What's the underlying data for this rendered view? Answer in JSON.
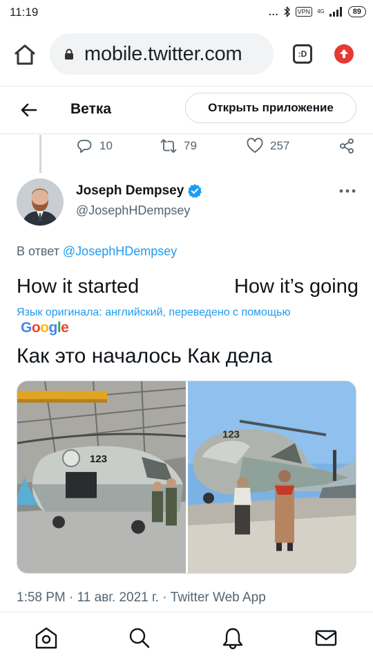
{
  "status_bar": {
    "time": "11:19",
    "dots": "...",
    "vpn": "VPN",
    "network": "4G",
    "battery": "89"
  },
  "browser": {
    "url": "mobile.twitter.com",
    "tabs_label": ":D"
  },
  "header": {
    "title": "Ветка",
    "open_app_label": "Открыть приложение"
  },
  "prev_tweet_actions": {
    "replies": "10",
    "retweets": "79",
    "likes": "257"
  },
  "tweet": {
    "author_name": "Joseph Dempsey",
    "author_handle": "@JosephHDempsey",
    "reply_prefix": "В ответ",
    "reply_handle": "@JosephHDempsey",
    "text_left": "How it started",
    "text_right": "How it’s going",
    "translation_note": "Язык оригинала: английский, переведено с помощью",
    "translation_text": "Как это началось Как дела",
    "timestamp": "1:58 PM · 11 авг. 2021 г. · Twitter Web App",
    "helicopter_number": "123"
  },
  "google_logo_letters": [
    "G",
    "o",
    "o",
    "g",
    "l",
    "e"
  ],
  "colors": {
    "twitter_blue": "#1d9bf0",
    "secondary_text": "#536471",
    "google_blue": "#4285f4",
    "google_red": "#ea4335",
    "google_yellow": "#fbbc05",
    "google_green": "#34a853"
  },
  "icons": {
    "home": "home-icon",
    "lock": "lock-icon",
    "tabs": "tabs-icon",
    "update": "update-icon",
    "back": "back-arrow-icon",
    "reply": "reply-icon",
    "retweet": "retweet-icon",
    "like": "heart-icon",
    "share": "share-icon",
    "verified": "verified-badge-icon",
    "more": "more-options-icon",
    "nav": [
      "home-icon",
      "search-icon",
      "notifications-bell-icon",
      "messages-envelope-icon"
    ]
  }
}
